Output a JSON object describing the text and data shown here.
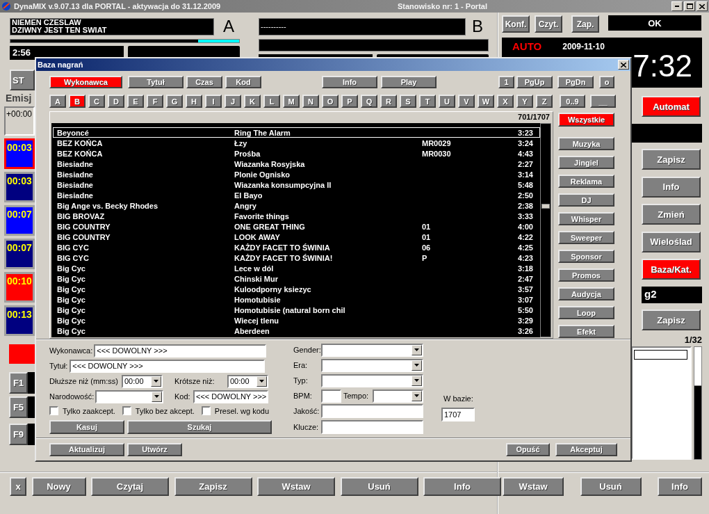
{
  "app_window": {
    "title": "DynaMIX v.9.07.13 dla PORTAL - aktywacja do 31.12.2009",
    "station": "Stanowisko nr: 1 - Portal"
  },
  "decks": [
    {
      "letter": "A",
      "artist": "NIEMEN CZESLAW",
      "title": "DZIWNY JEST TEN SWIAT",
      "level": 0.18,
      "time": "2:56",
      "button": "ST"
    },
    {
      "letter": "B",
      "artist": "----------"
    }
  ],
  "playlist": {
    "header": "Emisj",
    "offset": "+00:00",
    "items": [
      {
        "time": "00:03",
        "selected": true,
        "color": "#0000ff"
      },
      {
        "time": "00:03",
        "selected": false,
        "color": "#000080"
      },
      {
        "time": "00:07",
        "selected": false,
        "color": "#0000ff"
      },
      {
        "time": "00:07",
        "selected": false,
        "color": "#000080"
      },
      {
        "time": "00:10",
        "selected": false,
        "color": "#ff0000"
      },
      {
        "time": "00:13",
        "selected": false,
        "color": "#000080"
      }
    ]
  },
  "function_keys": [
    "F1",
    "F5",
    "F9"
  ],
  "bottom_buttons": [
    "x",
    "Nowy",
    "Czytaj",
    "Zapisz",
    "Wstaw",
    "Usuń",
    "Info"
  ],
  "right_panel": {
    "top_buttons": [
      "Konf.",
      "Czyt.",
      "Zap."
    ],
    "status": "OK",
    "mode": "AUTO",
    "date": "2009-11-10",
    "clock": "7:32",
    "side_items": [
      {
        "kind": "button",
        "label": "Automat",
        "on": true
      },
      {
        "kind": "display"
      },
      {
        "kind": "button",
        "label": "Zapisz",
        "on": false
      },
      {
        "kind": "button",
        "label": "Info",
        "on": false
      },
      {
        "kind": "button",
        "label": "Zmień",
        "on": false
      },
      {
        "kind": "button",
        "label": "Wieloślad",
        "on": false
      },
      {
        "kind": "button",
        "label": "Baza/Kat.",
        "on": true
      },
      {
        "kind": "display",
        "value": "g2"
      },
      {
        "kind": "button",
        "label": "Zapisz",
        "on": false
      }
    ],
    "counter": "1/32",
    "bottom_buttons": [
      "Wstaw",
      "Usuń",
      "Info"
    ]
  },
  "dialog": {
    "title": "Baza nagrań",
    "sort_buttons": [
      {
        "label": "Wykonawca",
        "selected": true
      },
      {
        "label": "Tytuł",
        "selected": false
      },
      {
        "label": "Czas",
        "selected": false
      },
      {
        "label": "Kod",
        "selected": false
      }
    ],
    "action_buttons": [
      "Info",
      "Play"
    ],
    "nav_buttons": [
      "1",
      "PgUp",
      "PgDn",
      "o"
    ],
    "letters": [
      {
        "label": "A",
        "selected": false
      },
      {
        "label": "B",
        "selected": true
      },
      {
        "label": "C",
        "selected": false
      },
      {
        "label": "D",
        "selected": false
      },
      {
        "label": "E",
        "selected": false
      },
      {
        "label": "F",
        "selected": false
      },
      {
        "label": "G",
        "selected": false
      },
      {
        "label": "H",
        "selected": false
      },
      {
        "label": "I",
        "selected": false
      },
      {
        "label": "J",
        "selected": false
      },
      {
        "label": "K",
        "selected": false
      },
      {
        "label": "L",
        "selected": false
      },
      {
        "label": "M",
        "selected": false
      },
      {
        "label": "N",
        "selected": false
      },
      {
        "label": "O",
        "selected": false
      },
      {
        "label": "P",
        "selected": false
      },
      {
        "label": "Q",
        "selected": false
      },
      {
        "label": "R",
        "selected": false
      },
      {
        "label": "S",
        "selected": false
      },
      {
        "label": "T",
        "selected": false
      },
      {
        "label": "U",
        "selected": false
      },
      {
        "label": "V",
        "selected": false
      },
      {
        "label": "W",
        "selected": false
      },
      {
        "label": "X",
        "selected": false
      },
      {
        "label": "Y",
        "selected": false
      },
      {
        "label": "Z",
        "selected": false
      }
    ],
    "extra_letters": [
      "0..9",
      "__"
    ],
    "count": "701/1707",
    "rows": [
      {
        "artist": "Beyoncé",
        "title": "Ring The Alarm",
        "time": "3:23",
        "selected": true
      },
      {
        "artist": "BEZ KOŃCA",
        "title": "Łzy",
        "code": "MR0029",
        "time": "3:24",
        "selected": false
      },
      {
        "artist": "BEZ KOŃCA",
        "title": "Prośba",
        "code": "MR0030",
        "time": "4:43",
        "selected": false
      },
      {
        "artist": "Biesiadne",
        "title": "Wiazanka Rosyjska",
        "time": "2:27",
        "selected": false
      },
      {
        "artist": "Biesiadne",
        "title": "Plonie Ognisko",
        "time": "3:14",
        "selected": false
      },
      {
        "artist": "Biesiadne",
        "title": "Wiazanka konsumpcyjna II",
        "time": "5:48",
        "selected": false
      },
      {
        "artist": "Biesiadne",
        "title": "El Bayo",
        "time": "2:50",
        "selected": false
      },
      {
        "artist": "Big Ange vs. Becky Rhodes",
        "title": "Angry",
        "time": "2:38",
        "selected": false
      },
      {
        "artist": "BIG BROVAZ",
        "title": "Favorite things",
        "time": "3:33",
        "selected": false
      },
      {
        "artist": "BIG COUNTRY",
        "title": "ONE GREAT THING",
        "code": "01",
        "time": "4:00",
        "selected": false
      },
      {
        "artist": "BIG COUNTRY",
        "title": "LOOK AWAY",
        "code": "01",
        "time": "4:22",
        "selected": false
      },
      {
        "artist": "BIG CYC",
        "title": "KAŻDY FACET TO ŚWINIA",
        "code": "06",
        "time": "4:25",
        "selected": false
      },
      {
        "artist": "BIG CYC",
        "title": "KAŻDY FACET TO ŚWINIA!",
        "code": "P",
        "time": "4:23",
        "selected": false
      },
      {
        "artist": "Big Cyc",
        "title": "Lece w dól",
        "time": "3:18",
        "selected": false
      },
      {
        "artist": "Big Cyc",
        "title": "Chinski Mur",
        "time": "2:47",
        "selected": false
      },
      {
        "artist": "Big Cyc",
        "title": "Kuloodporny ksiezyc",
        "time": "3:57",
        "selected": false
      },
      {
        "artist": "Big Cyc",
        "title": "Homotubisie",
        "time": "3:07",
        "selected": false
      },
      {
        "artist": "Big Cyc",
        "title": "Homotubisie (natural born chil",
        "time": "5:50",
        "selected": false
      },
      {
        "artist": "Big Cyc",
        "title": "Wiecej tlenu",
        "time": "3:29",
        "selected": false
      },
      {
        "artist": "Big Cyc",
        "title": "Aberdeen",
        "time": "3:26",
        "selected": false
      }
    ],
    "categories": [
      {
        "label": "Wszystkie",
        "selected": true
      },
      {
        "label": "Muzyka",
        "selected": false
      },
      {
        "label": "Jingiel",
        "selected": false
      },
      {
        "label": "Reklama",
        "selected": false
      },
      {
        "label": "DJ",
        "selected": false
      },
      {
        "label": "Whisper",
        "selected": false
      },
      {
        "label": "Sweeper",
        "selected": false
      },
      {
        "label": "Sponsor",
        "selected": false
      },
      {
        "label": "Promos",
        "selected": false
      },
      {
        "label": "Audycja",
        "selected": false
      },
      {
        "label": "Loop",
        "selected": false
      },
      {
        "label": "Efekt",
        "selected": false
      }
    ],
    "form": {
      "artist": {
        "label": "Wykonawca:",
        "value": "<<< DOWOLNY >>>"
      },
      "title": {
        "label": "Tytuł:",
        "value": "<<< DOWOLNY >>>"
      },
      "longer": {
        "label": "Dłuższe niż (mm:ss)",
        "value": "00:00"
      },
      "shorter": {
        "label": "Krótsze niż:",
        "value": "00:00"
      },
      "nationality": {
        "label": "Narodowość:"
      },
      "code": {
        "label": "Kod:",
        "value": "<<< DOWOLNY >>>"
      },
      "checkboxes": [
        {
          "label": "Tylko zaakcept.",
          "checked": false
        },
        {
          "label": "Tylko bez akcept.",
          "checked": false
        },
        {
          "label": "Presel. wg kodu",
          "checked": false
        }
      ],
      "buttons": [
        "Kasuj",
        "Szukaj"
      ],
      "gender": {
        "label": "Gender:"
      },
      "era": {
        "label": "Era:"
      },
      "type": {
        "label": "Typ:"
      },
      "bpm": {
        "label": "BPM:"
      },
      "tempo": {
        "label": "Tempo:"
      },
      "quality": {
        "label": "Jakość:"
      },
      "keys": {
        "label": "Klucze:"
      },
      "in_db": {
        "label": "W bazie:",
        "value": "1707"
      }
    },
    "footer_left": [
      "Aktualizuj",
      "Utwórz"
    ],
    "footer_right": [
      "Opuść",
      "Akceptuj"
    ]
  }
}
